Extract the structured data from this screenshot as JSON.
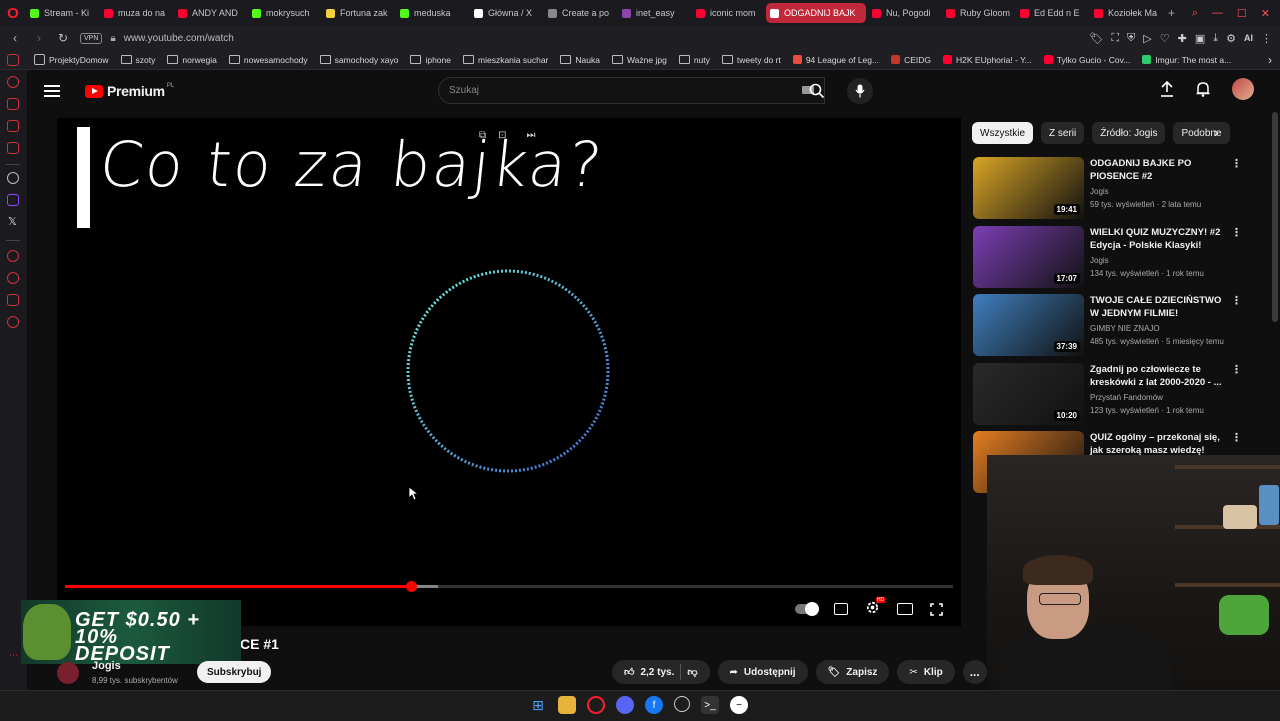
{
  "browser": {
    "tabs": [
      {
        "label": "Stream - Ki",
        "color": "#53fc18"
      },
      {
        "label": "muza do na",
        "color": "#ff0033"
      },
      {
        "label": "ANDY AND",
        "color": "#ff0033"
      },
      {
        "label": "mokrysuch",
        "color": "#53fc18"
      },
      {
        "label": "Fortuna zak",
        "color": "#f4d03f"
      },
      {
        "label": "meduska",
        "color": "#53fc18"
      },
      {
        "label": "Główna / X",
        "color": "#ffffff"
      },
      {
        "label": "Create a po",
        "color": "#888888"
      },
      {
        "label": "inet_easy",
        "color": "#8e44ad"
      },
      {
        "label": "iconic mom",
        "color": "#ff0033"
      },
      {
        "label": "ODGADNIJ BAJK",
        "color": "#ffffff",
        "active": true
      },
      {
        "label": "Nu, Pogodi",
        "color": "#ff0033"
      },
      {
        "label": "Ruby Gloom",
        "color": "#ff0033"
      },
      {
        "label": "Ed Edd n E",
        "color": "#ff0033"
      },
      {
        "label": "Koziołek Ma",
        "color": "#ff0033"
      }
    ],
    "new_tab_label": "+",
    "vpn_label": "VPN",
    "url": "www.youtube.com/watch",
    "ai_label": "AI",
    "bookmarks": [
      {
        "label": "ProjektyDomow",
        "type": "page"
      },
      {
        "label": "szoty",
        "type": "folder"
      },
      {
        "label": "norwegia",
        "type": "folder"
      },
      {
        "label": "nowesamochody",
        "type": "folder"
      },
      {
        "label": "samochody xayo",
        "type": "folder"
      },
      {
        "label": "iphone",
        "type": "folder"
      },
      {
        "label": "mieszkania suchar",
        "type": "folder"
      },
      {
        "label": "Nauka",
        "type": "folder"
      },
      {
        "label": "Ważne jpg",
        "type": "folder"
      },
      {
        "label": "nuty",
        "type": "folder"
      },
      {
        "label": "tweety do rt",
        "type": "folder"
      },
      {
        "label": "94 League of Leg...",
        "type": "site",
        "color": "#e74c3c"
      },
      {
        "label": "CEIDG",
        "type": "site",
        "color": "#c0392b"
      },
      {
        "label": "H2K EUphoria! - Y...",
        "type": "site",
        "color": "#ff0033"
      },
      {
        "label": "Tylko Gucio - Cov...",
        "type": "site",
        "color": "#ff0033"
      },
      {
        "label": "Imgur: The most a...",
        "type": "site",
        "color": "#2ecc71"
      }
    ]
  },
  "youtube": {
    "logo_text": "Premium",
    "region": "PL",
    "search_placeholder": "Szukaj",
    "video": {
      "overlay_text": "Co to za bajka?",
      "progress_percent": 39,
      "buffered_percent": 42,
      "title_visible_part": "CE #1"
    },
    "channel": {
      "name": "Jogis",
      "subscribers": "8,99 tys. subskrybentów",
      "subscribe_label": "Subskrybuj"
    },
    "actions": {
      "likes": "2,2 tys.",
      "share": "Udostępnij",
      "save": "Zapisz",
      "clip": "Klip",
      "more": "..."
    },
    "ad": {
      "text_line1": "GET $0.50 + 10%",
      "text_line2": "DEPOSIT"
    },
    "chips": [
      "Wszystkie",
      "Z serii",
      "Źródło: Jogis",
      "Podobne"
    ],
    "recommendations": [
      {
        "title": "ODGADNIJ BAJKE PO PIOSENCE #2",
        "channel": "Jogis",
        "meta": "59 tys. wyświetleń · 2 lata temu",
        "duration": "19:41",
        "thumb_color": "#d9a526"
      },
      {
        "title": "WIELKI QUIZ MUZYCZNY! #2 Edycja - Polskie Klasyki!",
        "channel": "Jogis",
        "meta": "134 tys. wyświetleń · 1 rok temu",
        "duration": "17:07",
        "thumb_color": "#7b3fb5"
      },
      {
        "title": "TWOJE CAŁE DZIECIŃSTWO W JEDNYM FILMIE!",
        "channel": "GIMBY NIE ZNAJO",
        "meta": "485 tys. wyświetleń · 5 miesięcy temu",
        "duration": "37:39",
        "thumb_color": "#3f7fbf"
      },
      {
        "title": "Zgadnij po człowiecze te kreskówki z lat 2000-2020 - ...",
        "channel": "Przystań Fandomów",
        "meta": "123 tys. wyświetleń · 1 rok temu",
        "duration": "10:20",
        "thumb_color": "#2a2a2a"
      },
      {
        "title": "QUIZ ogólny – przekonaj się, jak szeroką masz wiedzę!",
        "channel": "",
        "meta": "",
        "duration": "",
        "thumb_color": "#e67e22"
      }
    ]
  }
}
